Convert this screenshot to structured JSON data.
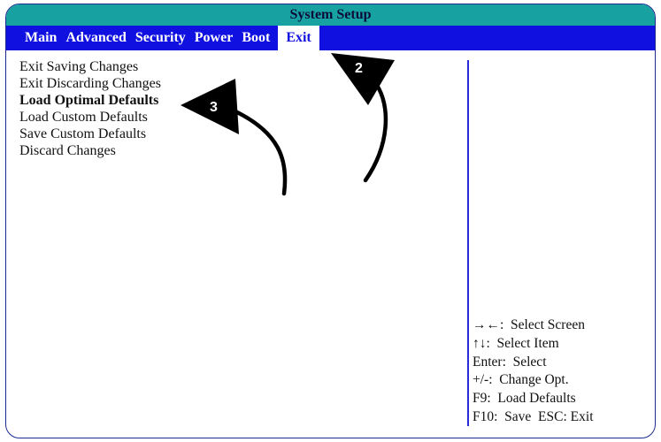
{
  "window": {
    "title": "System Setup"
  },
  "menu": {
    "tabs": [
      {
        "label": "Main"
      },
      {
        "label": "Advanced"
      },
      {
        "label": "Security"
      },
      {
        "label": "Power"
      },
      {
        "label": "Boot"
      },
      {
        "label": "Exit",
        "active": true
      }
    ]
  },
  "options": [
    {
      "label": "Exit Saving Changes"
    },
    {
      "label": "Exit Discarding Changes"
    },
    {
      "label": "Load Optimal Defaults",
      "selected": true
    },
    {
      "label": "Load Custom Defaults"
    },
    {
      "label": "Save Custom Defaults"
    },
    {
      "label": "Discard Changes"
    }
  ],
  "help": [
    "→←:  Select Screen",
    "↑↓:  Select Item",
    "Enter:  Select",
    "+/-:  Change Opt.",
    "F9:  Load Defaults",
    "F10:  Save  ESC: Exit"
  ],
  "annotations": {
    "step_tab": "2",
    "step_option": "3"
  },
  "colors": {
    "title_bar": "#17a1a1",
    "menu_bar": "#1010e0",
    "divider": "#2a2ad8",
    "annotation": "#000000"
  }
}
